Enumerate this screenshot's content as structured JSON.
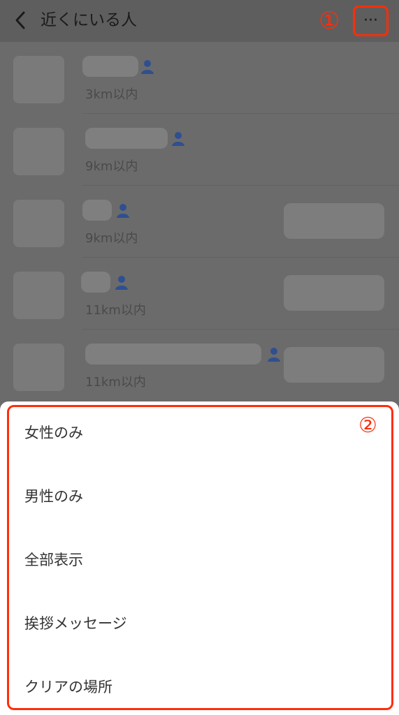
{
  "header": {
    "back_icon": "chevron-left-icon",
    "title": "近くにいる人",
    "more_label": "···",
    "callout": "①"
  },
  "list": [
    {
      "distance": "3km以内",
      "has_button": false
    },
    {
      "distance": "9km以内",
      "has_button": false
    },
    {
      "distance": "9km以内",
      "has_button": true
    },
    {
      "distance": "11km以内",
      "has_button": true
    },
    {
      "distance": "11km以内",
      "has_button": true
    }
  ],
  "menu": {
    "callout": "②",
    "items": [
      "女性のみ",
      "男性のみ",
      "全部表示",
      "挨拶メッセージ",
      "クリアの場所"
    ]
  },
  "colors": {
    "accent_red": "#ff2d0a",
    "person_icon_blue": "#2f4f91"
  }
}
